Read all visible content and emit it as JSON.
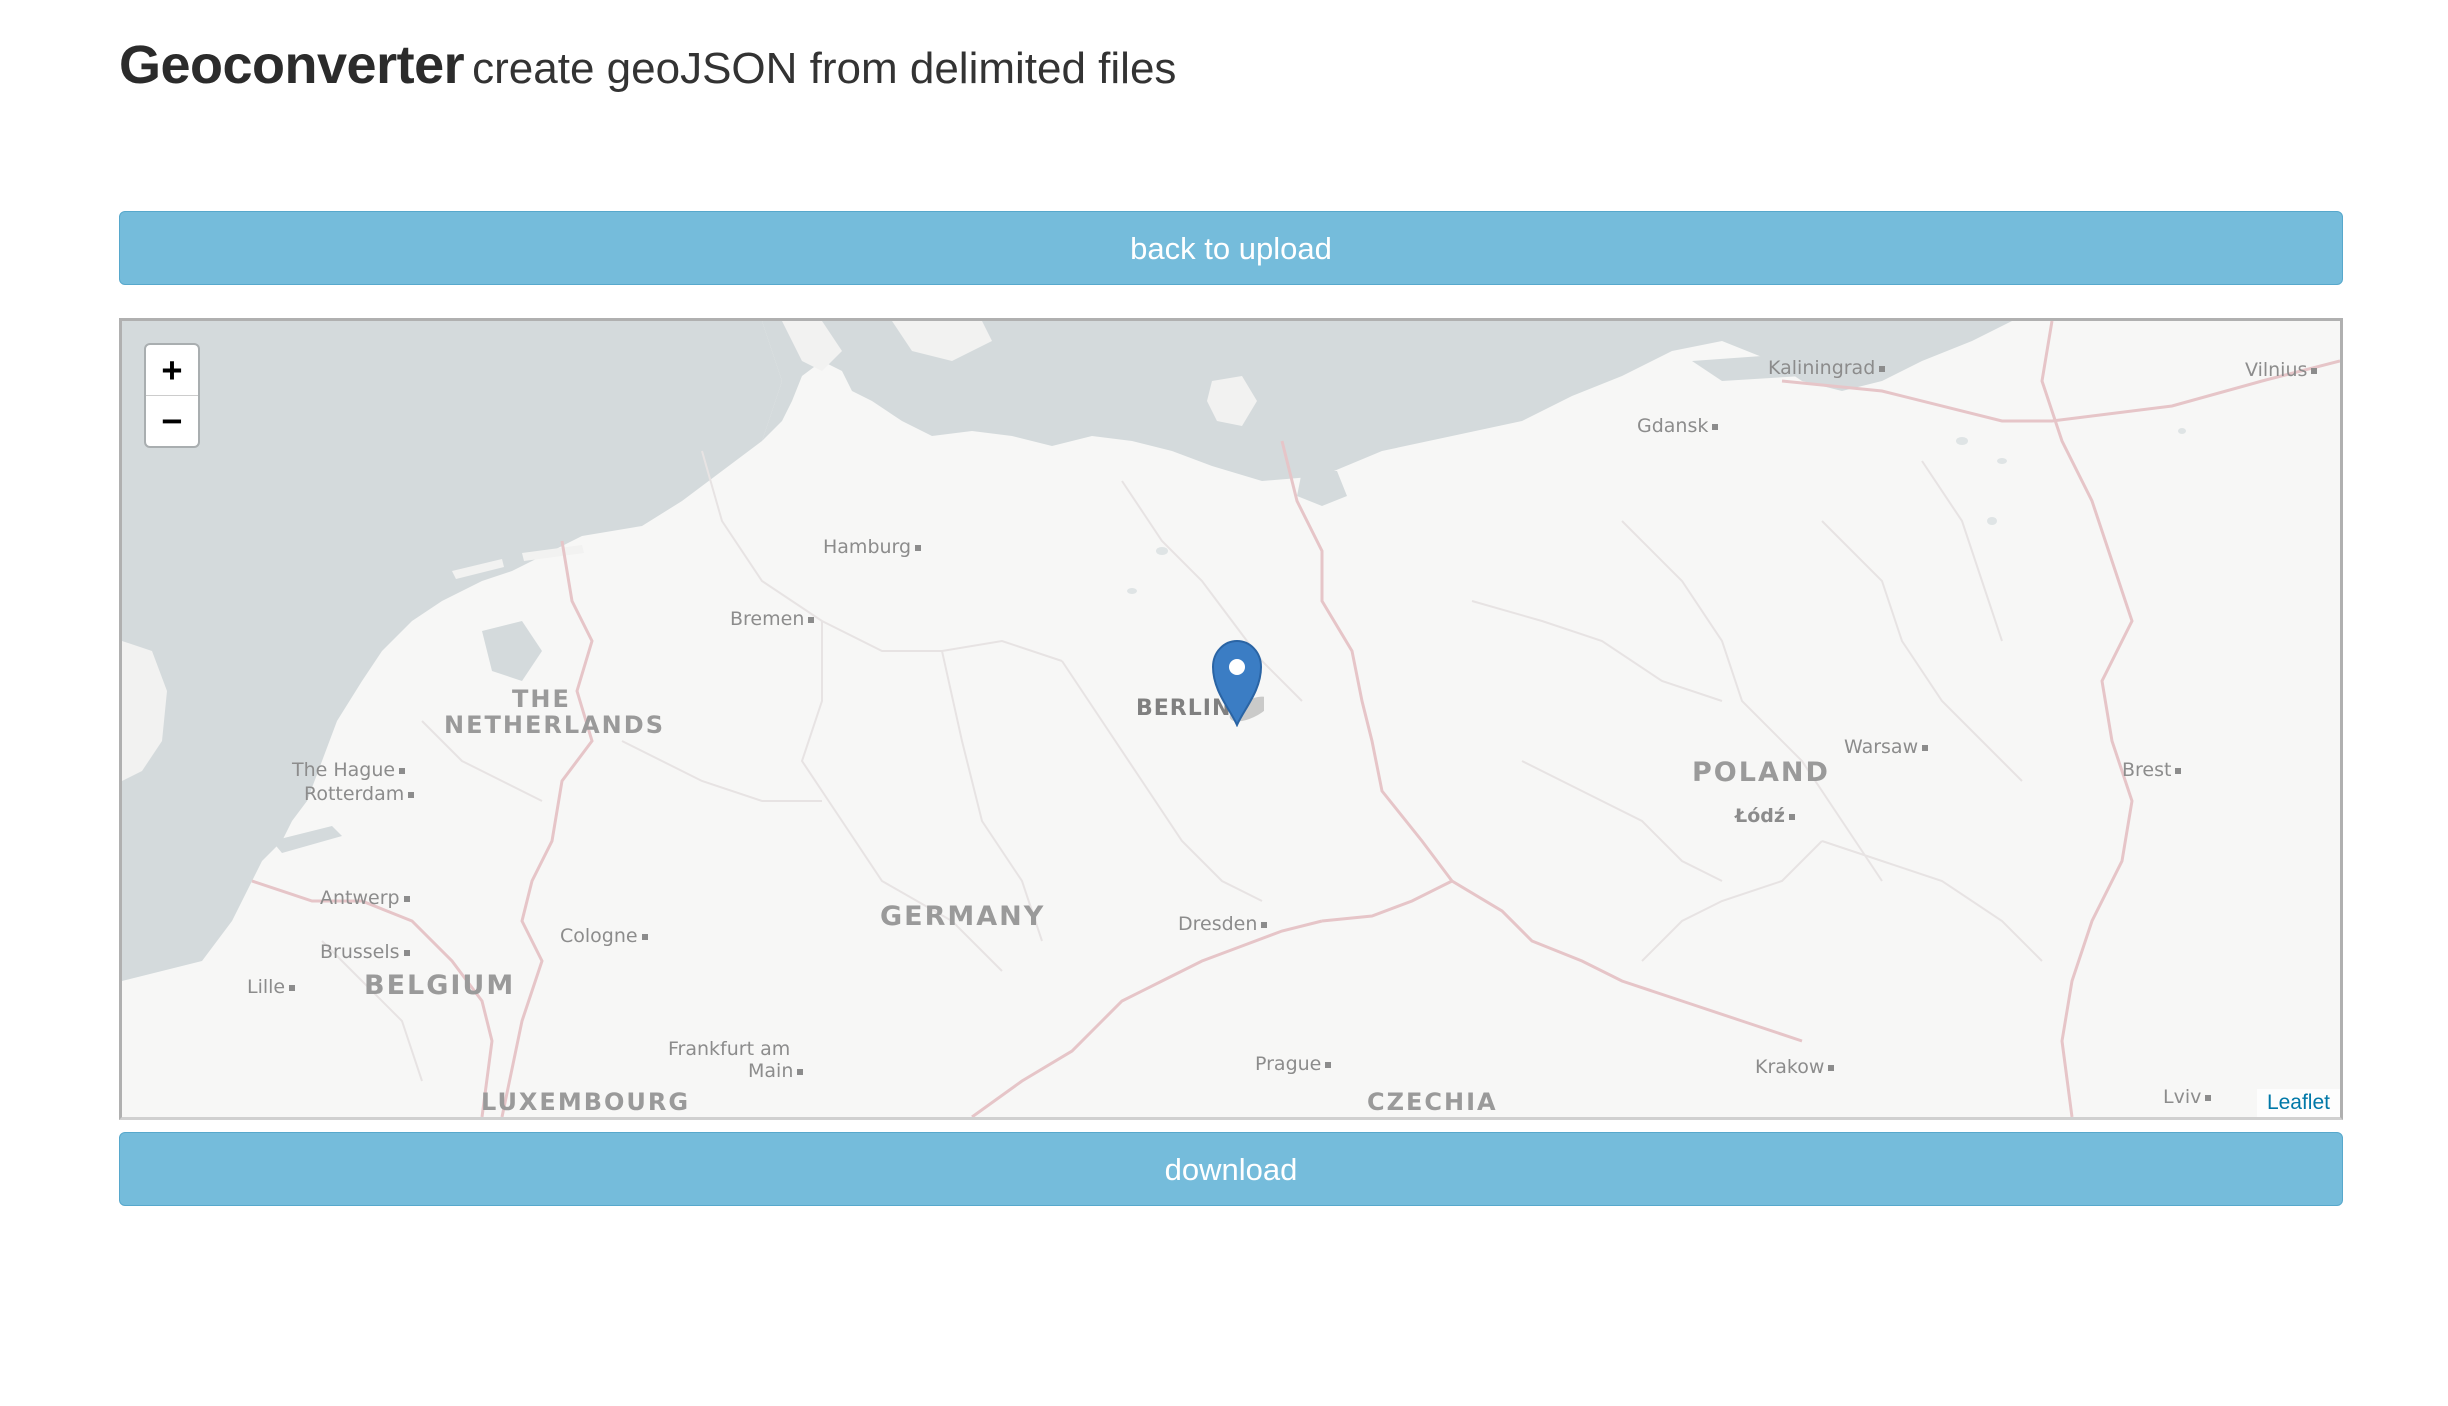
{
  "header": {
    "title": "Geoconverter",
    "subtitle": "create geoJSON from delimited files"
  },
  "buttons": {
    "back": "back to upload",
    "download": "download"
  },
  "map": {
    "zoom_in": "+",
    "zoom_out": "−",
    "attribution": "Leaflet",
    "marker_label": "map-marker-icon",
    "labels": {
      "kaliningrad": "Kaliningrad",
      "vilnius": "Vilnius",
      "gdansk": "Gdansk",
      "hamburg": "Hamburg",
      "bremen": "Bremen",
      "the": "THE",
      "netherlands": "NETHERLANDS",
      "berlin": "BERLIN",
      "warsaw": "Warsaw",
      "poland": "POLAND",
      "brest": "Brest",
      "lodz": "Łódź",
      "the_hague": "The Hague",
      "rotterdam": "Rotterdam",
      "antwerp": "Antwerp",
      "germany": "GERMANY",
      "dresden": "Dresden",
      "brussels": "Brussels",
      "cologne": "Cologne",
      "lille": "Lille",
      "belgium": "BELGIUM",
      "frankfurt1": "Frankfurt am",
      "frankfurt2": "Main",
      "prague": "Prague",
      "krakow": "Krakow",
      "luxembourg": "LUXEMBOURG",
      "czechia": "CZECHIA",
      "lviv": "Lviv"
    }
  },
  "colors": {
    "button": "#75bcdb",
    "water": "#d4dadc",
    "land": "#f7f7f6",
    "border": "#e6c5c8",
    "marker": "#3b7dc4"
  }
}
